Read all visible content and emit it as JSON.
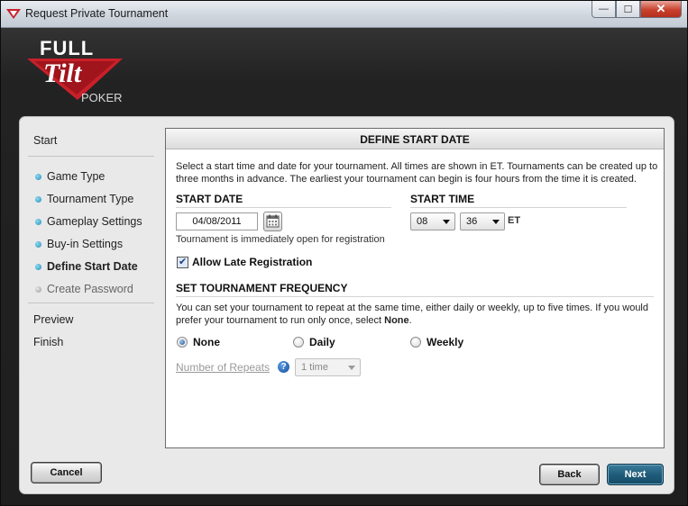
{
  "window": {
    "title": "Request Private Tournament",
    "minimize_label": "—",
    "maximize_label": "☐",
    "close_label": "✕"
  },
  "logo": {
    "line1": "FULL",
    "line2": "Tilt",
    "line3": "POKER",
    "colors": {
      "red": "#c8202a",
      "white": "#ffffff"
    }
  },
  "sidebar": {
    "start": "Start",
    "steps": [
      {
        "label": "Game Type",
        "state": "done"
      },
      {
        "label": "Tournament Type",
        "state": "done"
      },
      {
        "label": "Gameplay Settings",
        "state": "done"
      },
      {
        "label": "Buy-in Settings",
        "state": "done"
      },
      {
        "label": "Define Start Date",
        "state": "active"
      },
      {
        "label": "Create Password",
        "state": "disabled"
      }
    ],
    "preview": "Preview",
    "finish": "Finish"
  },
  "content": {
    "header": "DEFINE START DATE",
    "intro": "Select a start time and date for your tournament. All times are shown in ET. Tournaments can be created up to three months in advance. The earliest your tournament can begin is four hours from the time it is created.",
    "start_date_heading": "START DATE",
    "start_date_value": "04/08/2011",
    "open_note": "Tournament is immediately open for registration",
    "start_time_heading": "START TIME",
    "hour_value": "08",
    "minute_value": "36",
    "timezone": "ET",
    "late_registration_label": "Allow Late Registration",
    "late_registration_checked": true,
    "frequency_heading": "SET TOURNAMENT FREQUENCY",
    "frequency_text_1": "You can set your tournament to repeat at the same time, either daily or weekly, up to five times. If you would prefer your tournament to run only once, select ",
    "frequency_text_bold": "None",
    "frequency_text_2": ".",
    "frequency_options": [
      {
        "label": "None",
        "selected": true
      },
      {
        "label": "Daily",
        "selected": false
      },
      {
        "label": "Weekly",
        "selected": false
      }
    ],
    "repeats_label": "Number of Repeats",
    "repeats_value": "1 time",
    "help_glyph": "?"
  },
  "buttons": {
    "cancel": "Cancel",
    "back": "Back",
    "next": "Next"
  },
  "colors": {
    "accent_blue": "#1f5c7a",
    "bullet_blue": "#1f8fb8"
  },
  "icons": [
    "app-icon",
    "minimize-icon",
    "maximize-icon",
    "close-icon",
    "calendar-icon",
    "dropdown-arrow-icon",
    "help-icon",
    "bullet-icon"
  ]
}
